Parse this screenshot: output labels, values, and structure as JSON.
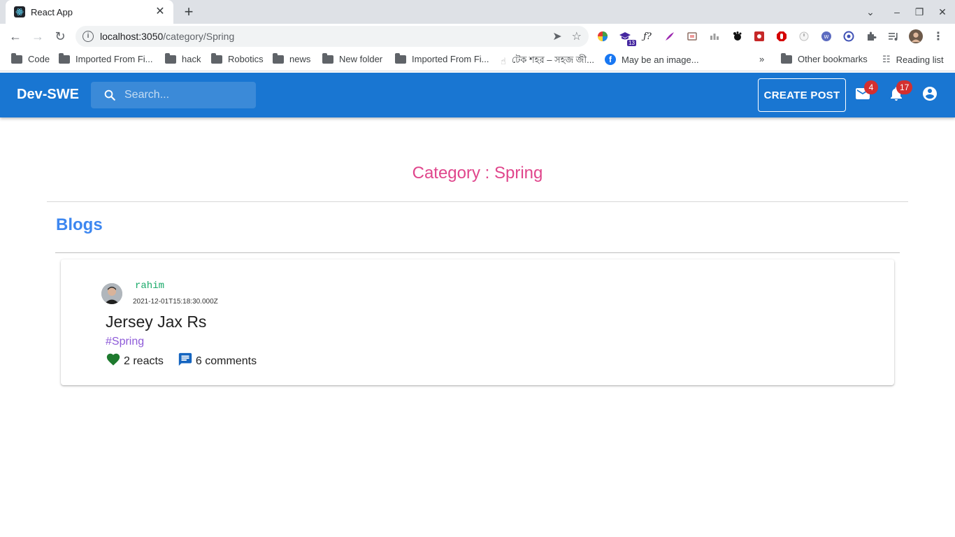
{
  "browser": {
    "tab_title": "React App",
    "url_host": "localhost:3050",
    "url_path": "/category/Spring",
    "bookmarks": [
      {
        "label": "Code"
      },
      {
        "label": "Imported From Fi..."
      },
      {
        "label": "hack"
      },
      {
        "label": "Robotics"
      },
      {
        "label": "news"
      },
      {
        "label": "New folder"
      },
      {
        "label": "Imported From Fi..."
      },
      {
        "label": "টেক শহর – সহজ জী..."
      },
      {
        "label": "May be an image..."
      }
    ],
    "other_bookmarks": "Other bookmarks",
    "reading_list": "Reading list",
    "ext_badge": "13"
  },
  "appbar": {
    "brand": "Dev-SWE",
    "search_placeholder": "Search...",
    "create_post": "CREATE POST",
    "mail_count": "4",
    "notif_count": "17"
  },
  "page": {
    "category_title": "Category : Spring",
    "blogs_heading": "Blogs"
  },
  "post": {
    "author": "rahim",
    "date": "2021-12-01T15:18:30.000Z",
    "title": "Jersey Jax Rs",
    "tag": "#Spring",
    "reacts": "2 reacts",
    "comments": "6 comments"
  },
  "colors": {
    "appbar": "#1976d2",
    "category_title": "#e0468c",
    "blogs_heading": "#3d87f0",
    "author": "#1aaa6a",
    "tag": "#8e5ad8",
    "heart": "#1e7a2e",
    "comment_icon": "#1565c0",
    "badge": "#d32f2f"
  }
}
